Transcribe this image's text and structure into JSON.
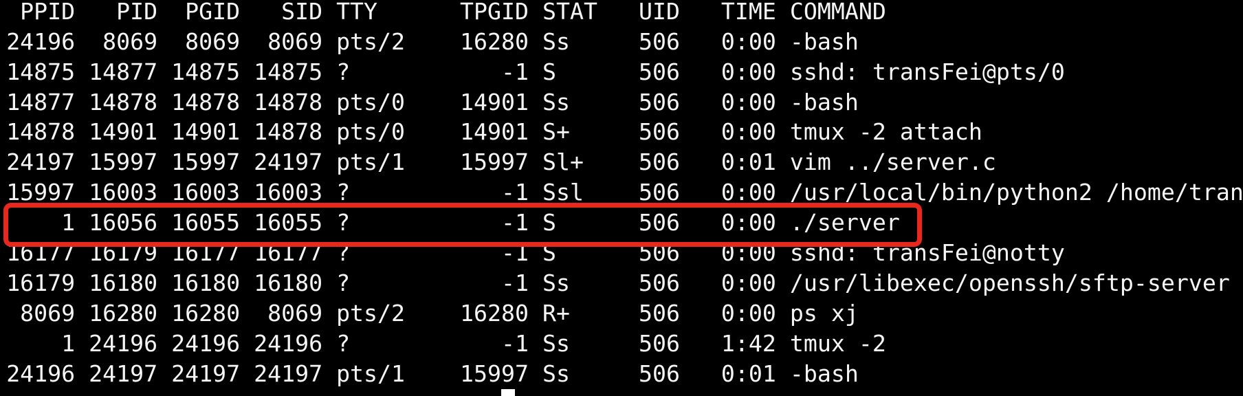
{
  "terminal": {
    "header": {
      "ppid": "PPID",
      "pid": "PID",
      "pgid": "PGID",
      "sid": "SID",
      "tty": "TTY",
      "tpgid": "TPGID",
      "stat": "STAT",
      "uid": "UID",
      "time": "TIME",
      "command": "COMMAND"
    },
    "rows": [
      {
        "ppid": "24196",
        "pid": "8069",
        "pgid": "8069",
        "sid": "8069",
        "tty": "pts/2",
        "tpgid": "16280",
        "stat": "Ss",
        "uid": "506",
        "time": "0:00",
        "command": "-bash"
      },
      {
        "ppid": "14875",
        "pid": "14877",
        "pgid": "14875",
        "sid": "14875",
        "tty": "?",
        "tpgid": "-1",
        "stat": "S",
        "uid": "506",
        "time": "0:00",
        "command": "sshd: transFei@pts/0"
      },
      {
        "ppid": "14877",
        "pid": "14878",
        "pgid": "14878",
        "sid": "14878",
        "tty": "pts/0",
        "tpgid": "14901",
        "stat": "Ss",
        "uid": "506",
        "time": "0:00",
        "command": "-bash"
      },
      {
        "ppid": "14878",
        "pid": "14901",
        "pgid": "14901",
        "sid": "14878",
        "tty": "pts/0",
        "tpgid": "14901",
        "stat": "S+",
        "uid": "506",
        "time": "0:00",
        "command": "tmux -2 attach"
      },
      {
        "ppid": "24197",
        "pid": "15997",
        "pgid": "15997",
        "sid": "24197",
        "tty": "pts/1",
        "tpgid": "15997",
        "stat": "Sl+",
        "uid": "506",
        "time": "0:01",
        "command": "vim ../server.c"
      },
      {
        "ppid": "15997",
        "pid": "16003",
        "pgid": "16003",
        "sid": "16003",
        "tty": "?",
        "tpgid": "-1",
        "stat": "Ssl",
        "uid": "506",
        "time": "0:00",
        "command": "/usr/local/bin/python2 /home/tran"
      },
      {
        "ppid": "1",
        "pid": "16056",
        "pgid": "16055",
        "sid": "16055",
        "tty": "?",
        "tpgid": "-1",
        "stat": "S",
        "uid": "506",
        "time": "0:00",
        "command": "./server",
        "highlighted": true
      },
      {
        "ppid": "16177",
        "pid": "16179",
        "pgid": "16177",
        "sid": "16177",
        "tty": "?",
        "tpgid": "-1",
        "stat": "S",
        "uid": "506",
        "time": "0:00",
        "command": "sshd: transFei@notty"
      },
      {
        "ppid": "16179",
        "pid": "16180",
        "pgid": "16180",
        "sid": "16180",
        "tty": "?",
        "tpgid": "-1",
        "stat": "Ss",
        "uid": "506",
        "time": "0:00",
        "command": "/usr/libexec/openssh/sftp-server"
      },
      {
        "ppid": "8069",
        "pid": "16280",
        "pgid": "16280",
        "sid": "8069",
        "tty": "pts/2",
        "tpgid": "16280",
        "stat": "R+",
        "uid": "506",
        "time": "0:00",
        "command": "ps xj"
      },
      {
        "ppid": "1",
        "pid": "24196",
        "pgid": "24196",
        "sid": "24196",
        "tty": "?",
        "tpgid": "-1",
        "stat": "Ss",
        "uid": "506",
        "time": "1:42",
        "command": "tmux -2"
      },
      {
        "ppid": "24196",
        "pid": "24197",
        "pgid": "24197",
        "sid": "24197",
        "tty": "pts/1",
        "tpgid": "15997",
        "stat": "Ss",
        "uid": "506",
        "time": "0:01",
        "command": "-bash"
      }
    ],
    "cursor": {
      "visible": true
    }
  },
  "colors": {
    "background": "#000000",
    "foreground": "#f5f5f5",
    "highlight": "#e8281e",
    "cursor": "#ffffff"
  }
}
